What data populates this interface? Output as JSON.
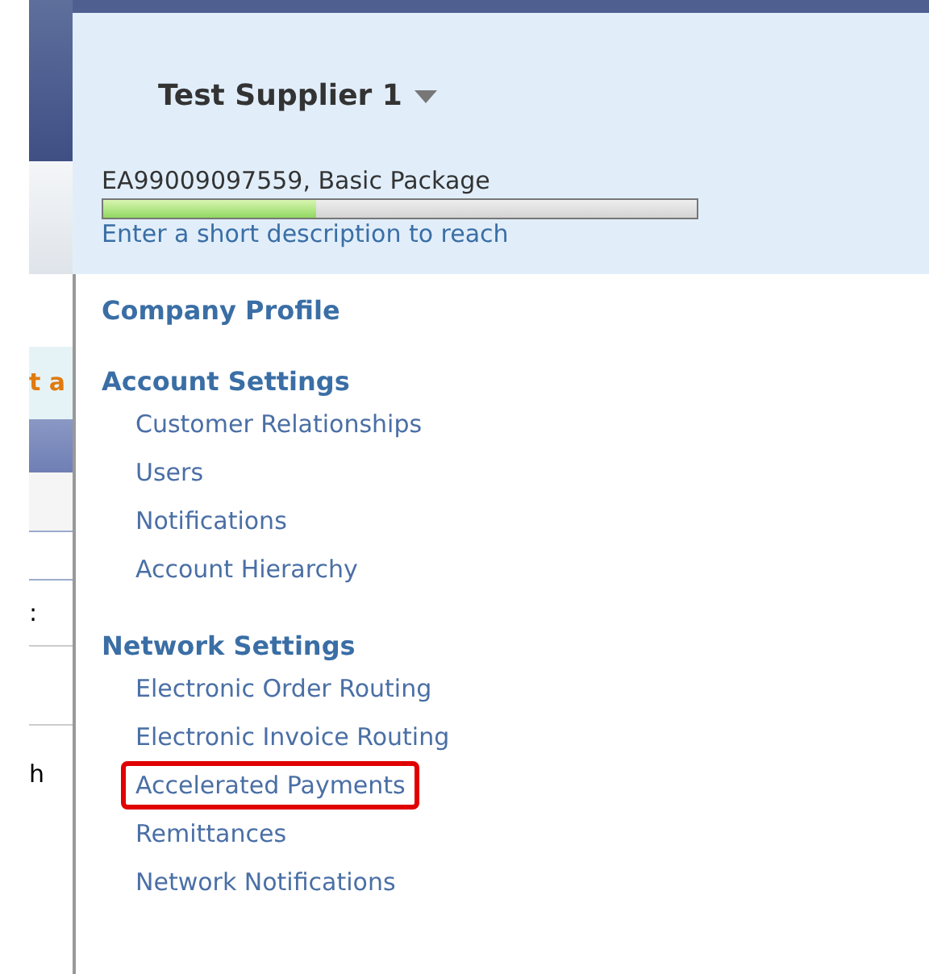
{
  "background_page": {
    "fragments": [
      "t a",
      ":",
      "h"
    ]
  },
  "account_header": {
    "title": "Test Supplier 1",
    "account_info": "EA99009097559, Basic Package",
    "profile_completion": {
      "level": 0.36
    },
    "hint_link": "Enter a short description to reach"
  },
  "menu": {
    "sections": [
      {
        "heading": "Company Profile"
      },
      {
        "heading": "Account Settings",
        "items": [
          {
            "label": "Customer Relationships",
            "highlighted": false
          },
          {
            "label": "Users",
            "highlighted": false
          },
          {
            "label": "Notifications",
            "highlighted": false
          },
          {
            "label": "Account Hierarchy",
            "highlighted": false
          }
        ]
      },
      {
        "heading": "Network Settings",
        "items": [
          {
            "label": "Electronic Order Routing",
            "highlighted": false
          },
          {
            "label": "Electronic Invoice Routing",
            "highlighted": false
          },
          {
            "label": "Accelerated Payments",
            "highlighted": true
          },
          {
            "label": "Remittances",
            "highlighted": false
          },
          {
            "label": "Network Notifications",
            "highlighted": false
          }
        ]
      }
    ]
  }
}
